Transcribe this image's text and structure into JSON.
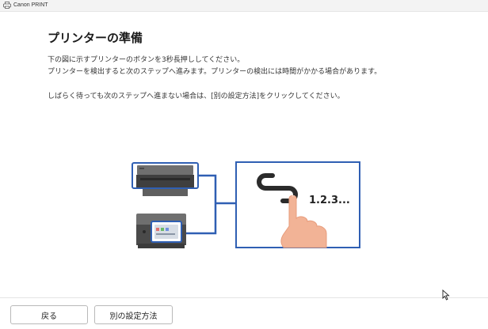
{
  "window": {
    "title": "Canon PRINT"
  },
  "page": {
    "title": "プリンターの準備",
    "line1": "下の図に示すプリンターのボタンを3秒長押ししてください。",
    "line2": "プリンターを検出すると次のステップへ進みます。プリンターの検出には時間がかかる場合があります。",
    "line3": "しばらく待っても次のステップへ進まない場合は、[別の設定方法]をクリックしてください。"
  },
  "illustration": {
    "step_text": "1.2.3...",
    "accent_color": "#2f5fb3"
  },
  "footer": {
    "back_label": "戻る",
    "alt_method_label": "別の設定方法"
  }
}
